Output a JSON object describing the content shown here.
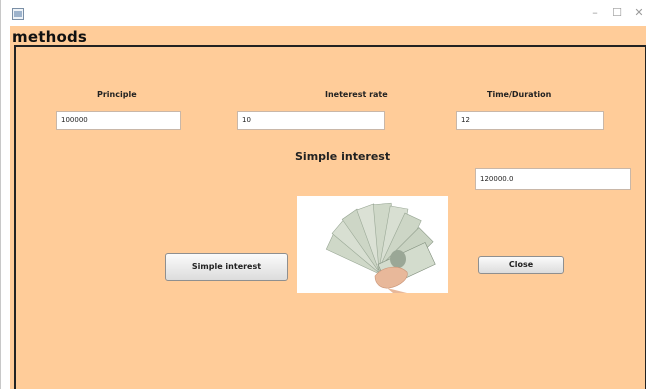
{
  "window": {
    "title": "methods",
    "controls": {
      "minimize": "–",
      "maximize": "☐",
      "close": "✕"
    }
  },
  "form": {
    "principle_label": "Principle",
    "principle_value": "100000",
    "rate_label": "Ineterest rate",
    "rate_value": "10",
    "time_label": "Time/Duration",
    "time_value": "12",
    "result_heading": "Simple interest",
    "result_value": "120000.0"
  },
  "buttons": {
    "simple_interest": "Simple interest",
    "close": "Close"
  },
  "image": {
    "icon": "money-fan-image"
  }
}
